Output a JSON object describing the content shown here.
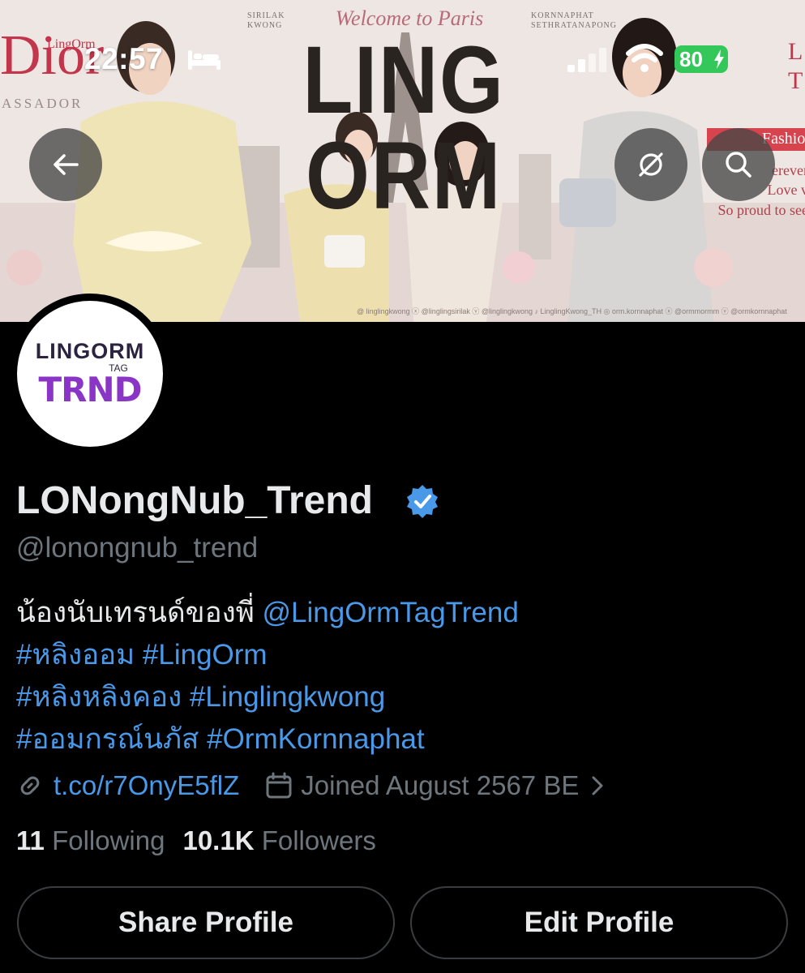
{
  "status_bar": {
    "time": "22:57",
    "battery": "80"
  },
  "banner": {
    "welcome": "Welcome to Paris",
    "title": "LING ORM",
    "left_names": "SIRILAK\nKWONG",
    "right_names": "KORNNAPHAT\nSETHRATANAPONG",
    "dior": "Dior",
    "dior_sub": "LingOrm",
    "assador": "ASSADOR",
    "fashion": "Fashio",
    "right_text": "erever\nLove v\nSo proud to see",
    "right_top": "L\nT",
    "socials": "@ linglingkwong   ⓧ @linglingsirilak ⓥ @linglingkwong   ♪ LinglingKwong_TH   ◎ orm.kornnaphat   ⓧ @ormmormm   ⓥ @ormkornnaphat"
  },
  "header": {
    "back_icon": "arrow-left-icon",
    "circle_icon": "circle-slash-icon",
    "search_icon": "search-icon"
  },
  "avatar": {
    "line1": "LINGORM",
    "line2": "TAG",
    "line3": "TRND"
  },
  "profile": {
    "display_name": "LONongNub_Trend",
    "handle": "@lonongnub_trend",
    "verified_color": "#4a99e9",
    "bio": {
      "line1_text": "น้องนับเทรนด์ของพี่ ",
      "line1_mention": "@LingOrmTagTrend",
      "line2": "#หลิงออม #LingOrm",
      "line3": "#หลิงหลิงคอง #Linglingkwong",
      "line4": "#ออมกรณ์นภัส #OrmKornnaphat"
    },
    "url": "t.co/r7OnyE5flZ",
    "joined": "Joined August 2567 BE",
    "following_count": "11",
    "following_label": "Following",
    "followers_count": "10.1K",
    "followers_label": "Followers"
  },
  "actions": {
    "share_label": "Share Profile",
    "edit_label": "Edit Profile"
  }
}
